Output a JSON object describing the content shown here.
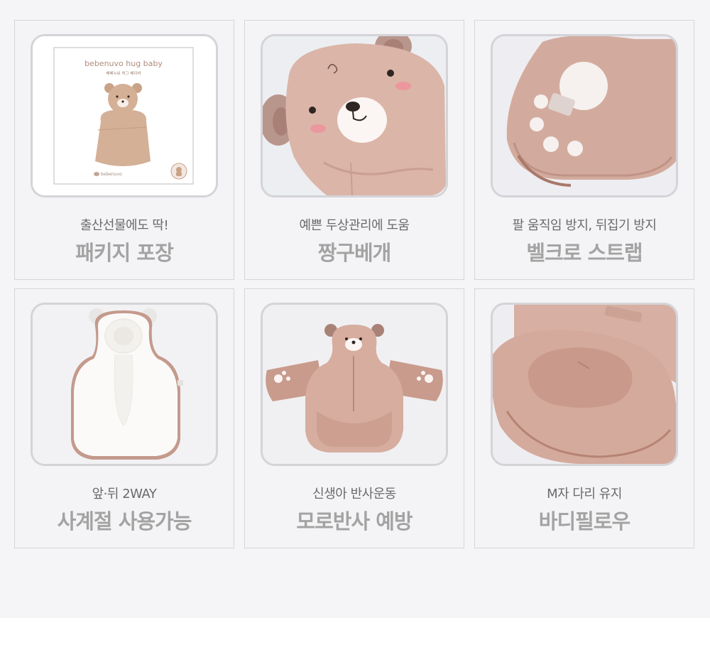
{
  "cards": [
    {
      "subtitle": "출산선물에도 딱!",
      "title": "패키지 포장",
      "image": {
        "kind": "package-box",
        "brand": "bebenuvo hug baby",
        "brand_ko": "베베누보 허그 베이비",
        "logo": "bebenuvo"
      }
    },
    {
      "subtitle": "예쁜 두상관리에 도움",
      "title": "짱구베개",
      "image": {
        "kind": "bear-head-pillow-closeup"
      }
    },
    {
      "subtitle": "팔 움직임 방지, 뒤집기 방지",
      "title": "벨크로 스트랩",
      "image": {
        "kind": "velcro-strap-paw-closeup"
      }
    },
    {
      "subtitle": "앞·뒤 2WAY",
      "title": "사계절 사용가능",
      "image": {
        "kind": "white-reverse-side-cushion"
      }
    },
    {
      "subtitle": "신생아 반사운동",
      "title": "모로반사 예방",
      "image": {
        "kind": "bear-cushion-with-arm-straps"
      }
    },
    {
      "subtitle": "M자 다리 유지",
      "title": "바디필로우",
      "image": {
        "kind": "body-pillow-closeup"
      }
    }
  ],
  "colors": {
    "page_background": "#f5f5f7",
    "card_border": "#d6d6d8",
    "product_pink": "#d8a99b",
    "subtitle_text": "#6a6a6a",
    "title_text": "#a3a3a3"
  }
}
